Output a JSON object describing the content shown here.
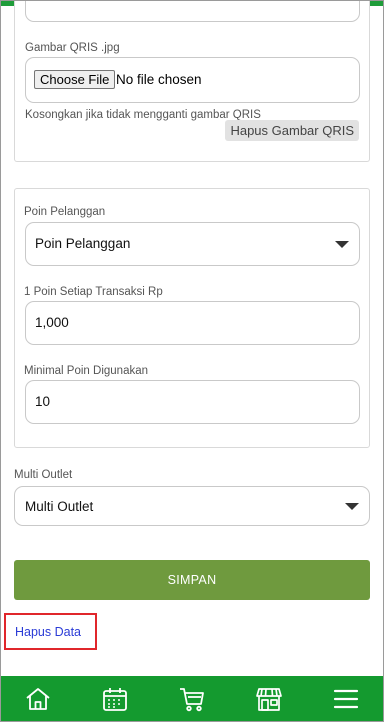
{
  "qris": {
    "label": "Gambar QRIS .jpg",
    "choose_file": "Choose File",
    "file_status": "No file chosen",
    "hint": "Kosongkan jika tidak mengganti gambar QRIS",
    "delete_button": "Hapus Gambar QRIS"
  },
  "points": {
    "type_label": "Poin Pelanggan",
    "type_value": "Poin Pelanggan",
    "per_transaction_label": "1 Poin Setiap Transaksi Rp",
    "per_transaction_value": "1,000",
    "minimum_label": "Minimal Poin Digunakan",
    "minimum_value": "10"
  },
  "outlet": {
    "label": "Multi Outlet",
    "value": "Multi Outlet"
  },
  "actions": {
    "save_label": "SIMPAN",
    "delete_data_label": "Hapus Data"
  },
  "nav": {
    "items": [
      "home-icon",
      "calendar-icon",
      "cart-icon",
      "store-icon",
      "menu-icon"
    ]
  },
  "colors": {
    "primary_green": "#149a2f",
    "save_button": "#6f9a3e",
    "link_blue": "#2a3bd6",
    "highlight_red": "#e0262b"
  }
}
